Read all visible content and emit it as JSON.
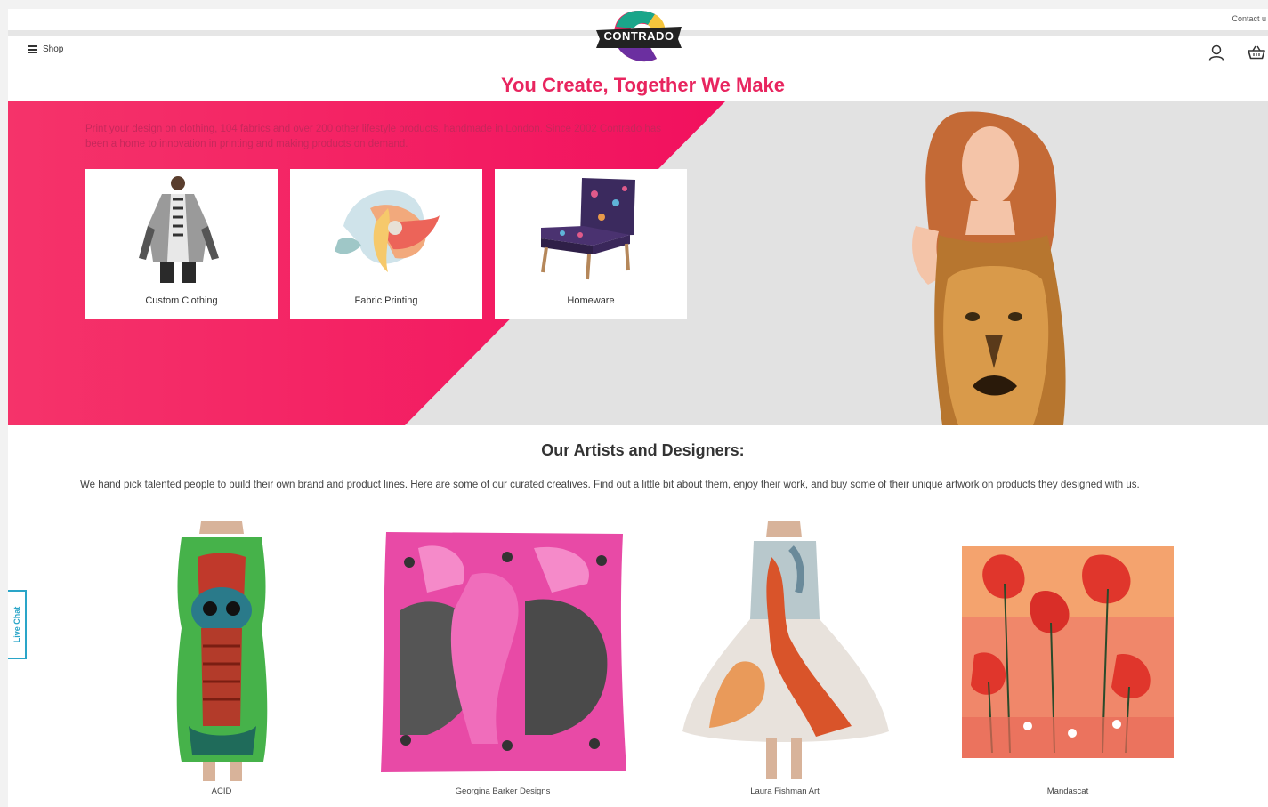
{
  "header": {
    "contact_label": "Contact u",
    "shop_label": "Shop",
    "logo_text": "CONTRADO"
  },
  "hero": {
    "tagline": "You Create, Together We Make",
    "intro": "Print your design on clothing, 104 fabrics and over 200 other lifestyle products, handmade in London. Since 2002 Contrado has been a home to innovation in printing and making products on demand.",
    "cards": [
      {
        "label": "Custom Clothing"
      },
      {
        "label": "Fabric Printing"
      },
      {
        "label": "Homeware"
      }
    ]
  },
  "artists": {
    "title": "Our Artists and Designers:",
    "description": "We hand pick talented people to build their own brand and product lines. Here are some of our curated creatives. Find out a little bit about them, enjoy their work, and buy some of their unique artwork on products they designed with us.",
    "items": [
      {
        "label": "ACID"
      },
      {
        "label": "Georgina Barker Designs"
      },
      {
        "label": "Laura Fishman Art"
      },
      {
        "label": "Mandascat"
      }
    ]
  },
  "live_chat": {
    "label": "Live Chat"
  },
  "colors": {
    "brand_pink": "#e8255f",
    "hero_gray": "#e2e2e2",
    "chat_blue": "#2aa5c8"
  }
}
